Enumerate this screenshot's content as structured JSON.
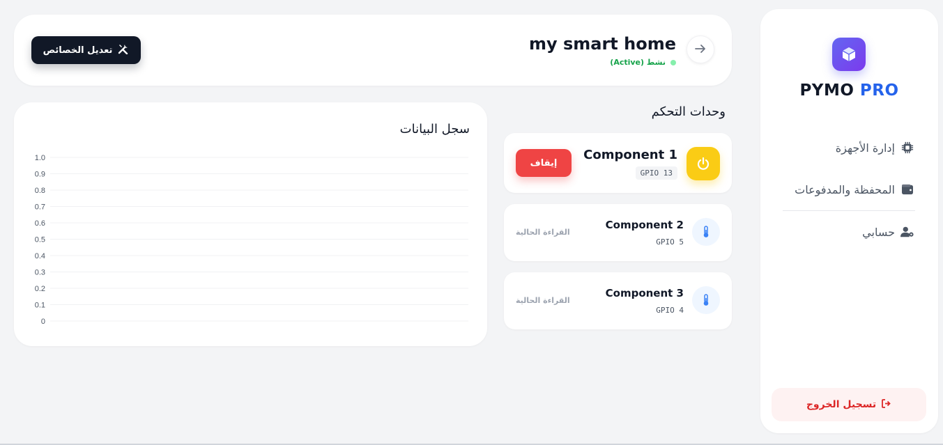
{
  "brand": {
    "name_part1": "PYMO",
    "name_part2": "PRO",
    "logo_icon": "cube-icon"
  },
  "sidebar": {
    "items": [
      {
        "label": "إدارة الأجهزة",
        "icon": "chip-icon"
      },
      {
        "label": "المحفظة والمدفوعات",
        "icon": "wallet-icon"
      },
      {
        "label": "حسابي",
        "icon": "user-gear-icon"
      }
    ],
    "logout_label": "تسجيل الخروج"
  },
  "header": {
    "device_name": "my smart home",
    "status_label": "نشط (Active)",
    "edit_button_label": "تعديل الخصائص"
  },
  "controls": {
    "section_title": "وحدات التحكم",
    "components": [
      {
        "name": "Component 1",
        "gpio": "GPIO 13",
        "action_label": "إيقاف",
        "icon": "power-icon"
      },
      {
        "name": "Component 2",
        "gpio": "GPIO 5",
        "reading_label": "القراءة الحالية",
        "icon": "thermometer-icon"
      },
      {
        "name": "Component 3",
        "gpio": "GPIO 4",
        "reading_label": "القراءة الحالية",
        "icon": "thermometer-icon"
      }
    ]
  },
  "chart_panel": {
    "title": "سجل البيانات"
  },
  "chart_data": {
    "type": "line",
    "title": "سجل البيانات",
    "xlabel": "",
    "ylabel": "",
    "ylim": [
      0,
      1
    ],
    "yticks": [
      "1.0",
      "0.9",
      "0.8",
      "0.7",
      "0.6",
      "0.5",
      "0.4",
      "0.3",
      "0.2",
      "0.1",
      "0"
    ],
    "series": [],
    "grid": true
  },
  "colors": {
    "accent": "#2563eb",
    "logo_gradient_start": "#6366f1",
    "logo_gradient_end": "#7c3aed",
    "status_active": "#16a34a",
    "danger": "#ef4444",
    "power_yellow": "#facc15",
    "dark_button": "#111827"
  }
}
